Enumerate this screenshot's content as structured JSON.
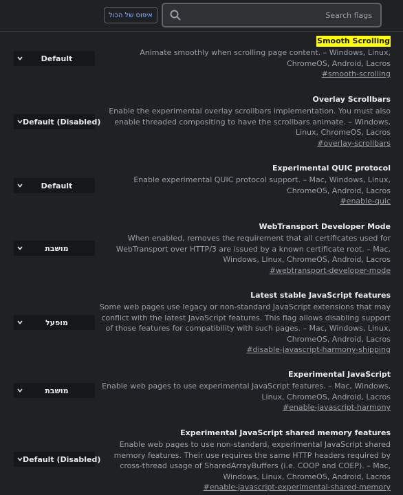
{
  "header": {
    "reset_label": "איפוס של הכול",
    "search_placeholder": "Search flags"
  },
  "experiments": [
    {
      "title": "Smooth Scrolling",
      "description": "Animate smoothly when scrolling page content. – Windows, Linux, ChromeOS, Android, Lacros",
      "link": "#smooth-scrolling",
      "selected": "Default",
      "highlighted": true
    },
    {
      "title": "Overlay Scrollbars",
      "description": "Enable the experimental overlay scrollbars implementation. You must also enable threaded compositing to have the scrollbars animate. – Windows, Linux, ChromeOS, Lacros",
      "link": "#overlay-scrollbars",
      "selected": "Default (Disabled)"
    },
    {
      "title": "Experimental QUIC protocol",
      "description": "Enable experimental QUIC protocol support. – Mac, Windows, Linux, ChromeOS, Android, Lacros",
      "link": "#enable-quic",
      "selected": "Default"
    },
    {
      "title": "WebTransport Developer Mode",
      "description": "When enabled, removes the requirement that all certificates used for WebTransport over HTTP/3 are issued by a known certificate root. – Mac, Windows, Linux, ChromeOS, Android, Lacros",
      "link": "#webtransport-developer-mode",
      "selected": "מושבת"
    },
    {
      "title": "Latest stable JavaScript features",
      "description": "Some web pages use legacy or non-standard JavaScript extensions that may conflict with the latest JavaScript features. This flag allows disabling support of those features for compatibility with such pages. – Mac, Windows, Linux, ChromeOS, Android, Lacros",
      "link": "#disable-javascript-harmony-shipping",
      "selected": "מופעל"
    },
    {
      "title": "Experimental JavaScript",
      "description": "Enable web pages to use experimental JavaScript features. – Mac, Windows, Linux, ChromeOS, Android, Lacros",
      "link": "#enable-javascript-harmony",
      "selected": "מושבת"
    },
    {
      "title": "Experimental JavaScript shared memory features",
      "description": "Enable web pages to use non-standard, experimental JavaScript shared memory features. Their use requires the same HTTP headers required by cross-thread usage of SharedArrayBuffers (i.e. COOP and COEP). – Mac, Windows, Linux, ChromeOS, Android, Lacros",
      "link": "#enable-javascript-experimental-shared-memory",
      "selected": "Default (Disabled)"
    }
  ]
}
